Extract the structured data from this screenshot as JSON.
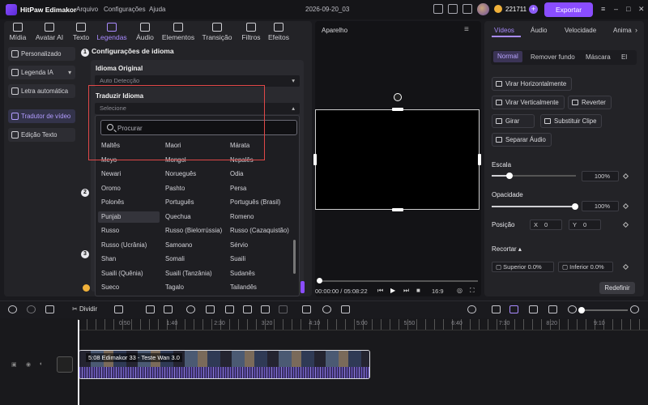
{
  "app": {
    "name": "HitPaw Edimakor",
    "menus": [
      "Arquivo",
      "Configurações",
      "Ajuda"
    ],
    "project": "2026-09-20_03",
    "credits": "221711",
    "export": "Exportar"
  },
  "tabs": [
    "Mídia",
    "Avatar AI",
    "Texto",
    "Legendas",
    "Áudio",
    "Elementos",
    "Transição",
    "Filtros",
    "Efeitos"
  ],
  "side": [
    "Personalizado",
    "Legenda IA",
    "Letra automática",
    "Tradutor de vídeo",
    "Edição Texto"
  ],
  "section1": "Configurações de idioma",
  "section2_num": "2",
  "section3_num": "3",
  "orig_label": "Idioma Original",
  "orig_value": "Auto Detecção",
  "trans_label": "Traduzir Idioma",
  "trans_value": "Selecione",
  "search_placeholder": "Procurar",
  "languages": [
    [
      "Maltês",
      "Maori",
      "Márata"
    ],
    [
      "Meyo",
      "Mongol",
      "Nepalês"
    ],
    [
      "Newari",
      "Norueguês",
      "Odia"
    ],
    [
      "Oromo",
      "Pashto",
      "Persa"
    ],
    [
      "Polonês",
      "Português",
      "Português (Brasil)"
    ],
    [
      "Punjab",
      "Quechua",
      "Romeno"
    ],
    [
      "Russo",
      "Russo (Bielorrússia)",
      "Russo (Cazaquistão)"
    ],
    [
      "Russo (Ucrânia)",
      "Samoano",
      "Sérvio"
    ],
    [
      "Shan",
      "Somali",
      "Suaili"
    ],
    [
      "Suaili (Quênia)",
      "Suaili (Tanzânia)",
      "Sudanês"
    ],
    [
      "Sueco",
      "Tagalo",
      "Tailandês"
    ]
  ],
  "preview": {
    "title": "Aparelho",
    "time": "00:00:00 / 05:08:22",
    "ratio": "16:9"
  },
  "right": {
    "tabs": [
      "Vídeos",
      "Áudio",
      "Velocidade",
      "Anima"
    ],
    "subtabs": [
      "Normal",
      "Remover fundo",
      "Máscara",
      "El"
    ],
    "buttons": [
      "Virar Horizontalmente",
      "Virar Verticalmente",
      "Reverter",
      "Girar",
      "Substituir Clipe",
      "Separar Áudio"
    ],
    "scale_label": "Escala",
    "scale_value": "100%",
    "opacity_label": "Opacidade",
    "opacity_value": "100%",
    "position_label": "Posição",
    "pos_x_label": "X",
    "pos_x": "0",
    "pos_y_label": "Y",
    "pos_y": "0",
    "crop_label": "Recortar",
    "top_label": "Superior",
    "top_value": "0.0%",
    "bottom_label": "Inferior",
    "bottom_value": "0.0%",
    "reset": "Redefinir"
  },
  "timeline": {
    "split": "Dividir",
    "ruler": [
      "0:50",
      "1:40",
      "2:30",
      "3:20",
      "4:10",
      "5:00",
      "5:50",
      "6:40",
      "7:30",
      "8:20",
      "9:10"
    ],
    "clip": "5:08 Edimakor 33 - Teste Wan 3.0"
  }
}
